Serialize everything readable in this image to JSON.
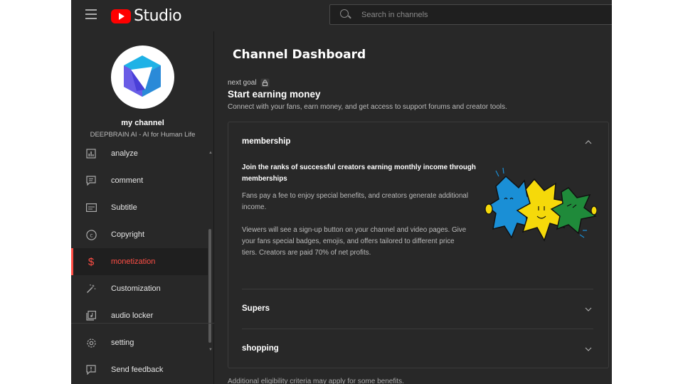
{
  "header": {
    "logo_text": "Studio",
    "search_placeholder": "Search in channels"
  },
  "channel": {
    "name": "my channel",
    "subtitle": "DEEPBRAIN AI - AI for Human Life"
  },
  "sidebar": {
    "items": [
      {
        "label": "analyze",
        "icon": "analytics-icon"
      },
      {
        "label": "comment",
        "icon": "comment-icon"
      },
      {
        "label": "Subtitle",
        "icon": "subtitles-icon"
      },
      {
        "label": "Copyright",
        "icon": "copyright-icon"
      },
      {
        "label": "monetization",
        "icon": "dollar-icon",
        "active": true
      },
      {
        "label": "Customization",
        "icon": "magic-wand-icon"
      },
      {
        "label": "audio locker",
        "icon": "audio-library-icon"
      }
    ],
    "bottom_items": [
      {
        "label": "setting",
        "icon": "gear-icon"
      },
      {
        "label": "Send feedback",
        "icon": "feedback-icon"
      }
    ]
  },
  "main": {
    "title": "Channel Dashboard",
    "goal_label": "next goal",
    "goal_title": "Start earning money",
    "goal_desc": "Connect with your fans, earn money, and get access to support forums and creator tools.",
    "sections": {
      "membership": {
        "title": "membership",
        "headline": "Join the ranks of successful creators earning monthly income through memberships",
        "para1": "Fans pay a fee to enjoy special benefits, and creators generate additional income.",
        "para2": "Viewers will see a sign-up button on your channel and video pages. Give your fans special badges, emojis, and offers tailored to different price tiers. Creators are paid 70% of net profits."
      },
      "supers": {
        "title": "Supers"
      },
      "shopping": {
        "title": "shopping"
      }
    },
    "footer_note": "Additional eligibility criteria may apply for some benefits."
  },
  "colors": {
    "background": "#282828",
    "accent": "#ff4e45",
    "brand": "#ff0000"
  }
}
